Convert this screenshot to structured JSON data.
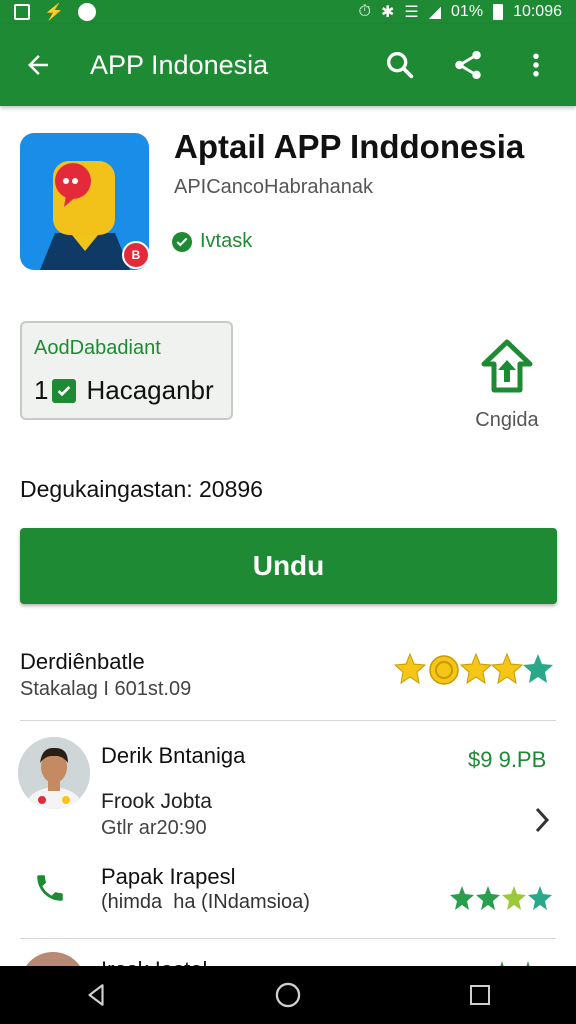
{
  "status_bar": {
    "battery": "01%",
    "time": "10:096"
  },
  "app_bar": {
    "title": "APP Indonesia"
  },
  "app": {
    "title": "Aptail APP Inddonesia",
    "developer": "APICancoHabrahanak",
    "verified_text": "Ivtask",
    "badge": "B"
  },
  "info_box": {
    "label": "AodDabadiant",
    "count": "1",
    "value": "Hacaganbr"
  },
  "cngida_label": "Cngida",
  "downloads": "Degukaingastan: 20896",
  "install_label": "Undu",
  "ratings": {
    "title": "Derdiênbatle",
    "subtitle": "Stakalag I 601st.09"
  },
  "reviews": [
    {
      "name": "Derik Bntaniga",
      "price": "$9 9.PB",
      "line1": "Frook Jobta",
      "line2": "Gtlr ar20:90"
    },
    {
      "name": "Papak Irapesl",
      "line1": "(himda  ha (INdamsioa)"
    }
  ],
  "partial_row": {
    "text": "Irosk Iastel"
  },
  "colors": {
    "primary": "#1e8a34",
    "star_gold": "#f5c518",
    "star_green": "#2a9d4f",
    "star_teal": "#2aa98a"
  },
  "icons": [
    "back-arrow-icon",
    "search-icon",
    "share-icon",
    "more-vert-icon",
    "check-circle-icon",
    "home-upload-icon",
    "chevron-right-icon",
    "phone-icon",
    "nav-back-icon",
    "nav-home-icon",
    "nav-recents-icon"
  ]
}
